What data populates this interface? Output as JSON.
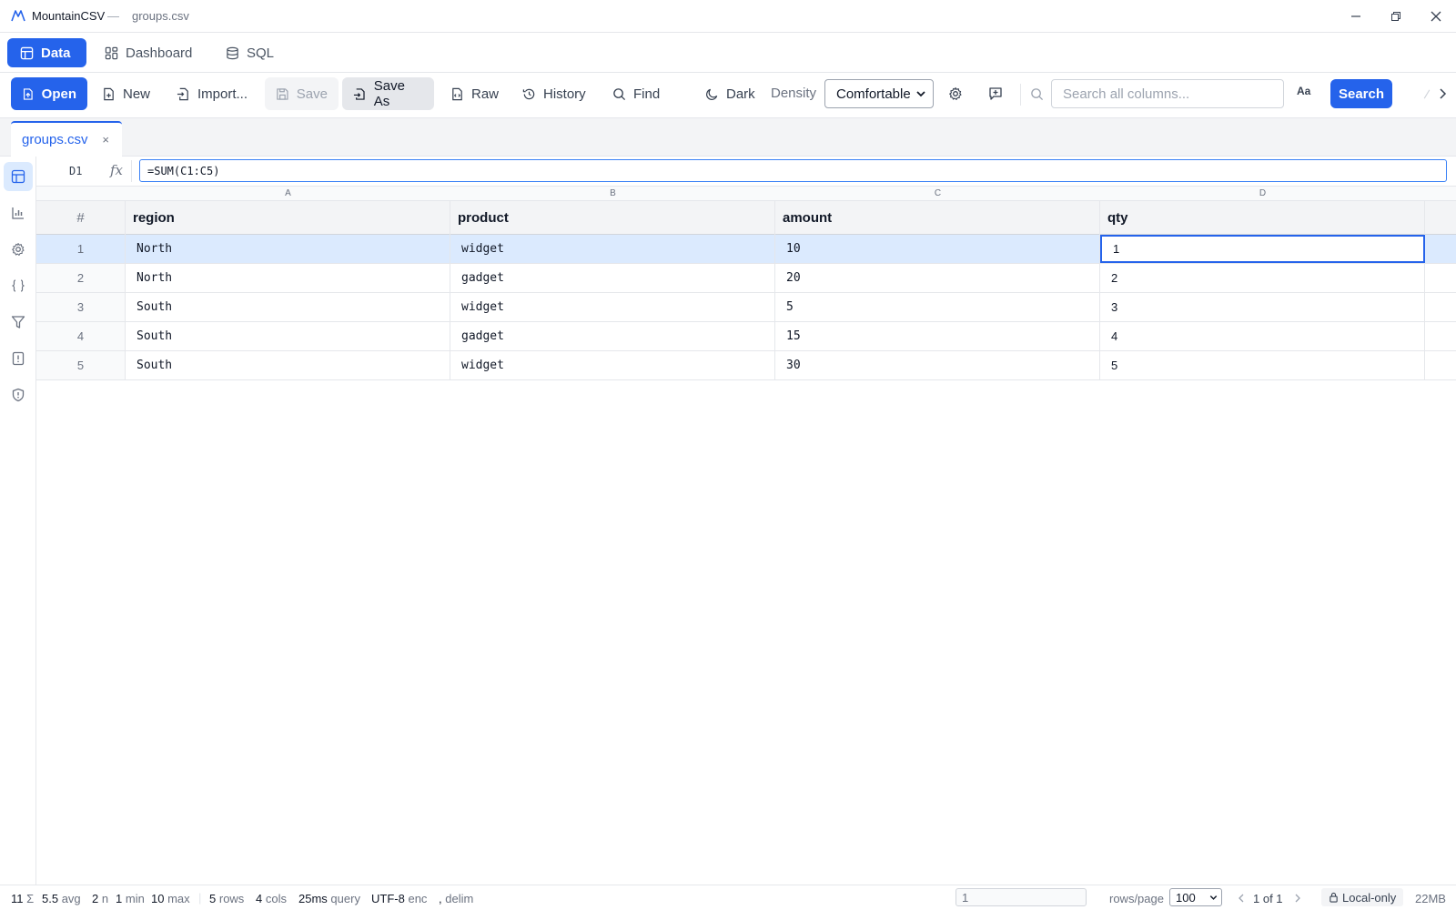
{
  "app": {
    "name": "MountainCSV",
    "separator": "—",
    "file": "groups.csv"
  },
  "views": [
    {
      "label": "Data",
      "icon": "table-icon",
      "active": true
    },
    {
      "label": "Dashboard",
      "icon": "dashboard-icon",
      "active": false
    },
    {
      "label": "SQL",
      "icon": "database-icon",
      "active": false
    }
  ],
  "toolbar": {
    "open": "Open",
    "new": "New",
    "import": "Import...",
    "save": "Save",
    "save_as": "Save As",
    "raw": "Raw",
    "history": "History",
    "find": "Find",
    "dark": "Dark",
    "density_label": "Density",
    "density_value": "Comfortable",
    "search_placeholder": "Search all columns...",
    "case_toggle": "Aa",
    "search": "Search"
  },
  "tabs": [
    {
      "label": "groups.csv",
      "close": "×"
    }
  ],
  "formula": {
    "cell_ref": "D1",
    "fx": "fx",
    "value": "=SUM(C1:C5)"
  },
  "grid": {
    "col_letters": [
      "A",
      "B",
      "C",
      "D"
    ],
    "row_header": "#",
    "columns": [
      "region",
      "product",
      "amount",
      "qty"
    ],
    "rows": [
      {
        "n": "1",
        "cells": [
          "North",
          "widget",
          "10",
          "1"
        ]
      },
      {
        "n": "2",
        "cells": [
          "North",
          "gadget",
          "20",
          "2"
        ]
      },
      {
        "n": "3",
        "cells": [
          "South",
          "widget",
          "5",
          "3"
        ]
      },
      {
        "n": "4",
        "cells": [
          "South",
          "gadget",
          "15",
          "4"
        ]
      },
      {
        "n": "5",
        "cells": [
          "South",
          "widget",
          "30",
          "5"
        ]
      }
    ],
    "selected_row": 1,
    "active_cell": "D1"
  },
  "status": {
    "sum": "11",
    "sum_label": "Σ",
    "avg": "5.5",
    "avg_label": "avg",
    "count": "2",
    "count_label": "n",
    "min": "1",
    "min_label": "min",
    "max": "10",
    "max_label": "max",
    "rows": "5",
    "rows_label": "rows",
    "cols": "4",
    "cols_label": "cols",
    "query": "25ms",
    "query_label": "query",
    "enc": "UTF-8",
    "enc_label": "enc",
    "delim": ",",
    "delim_label": "delim",
    "goto_value": "1",
    "rows_per_page_label": "rows/page",
    "rows_per_page": "100",
    "page": "1 of 1",
    "local": "Local-only",
    "memory": "22MB"
  },
  "colors": {
    "accent": "#2563eb",
    "selected_row": "#dbeafe"
  }
}
